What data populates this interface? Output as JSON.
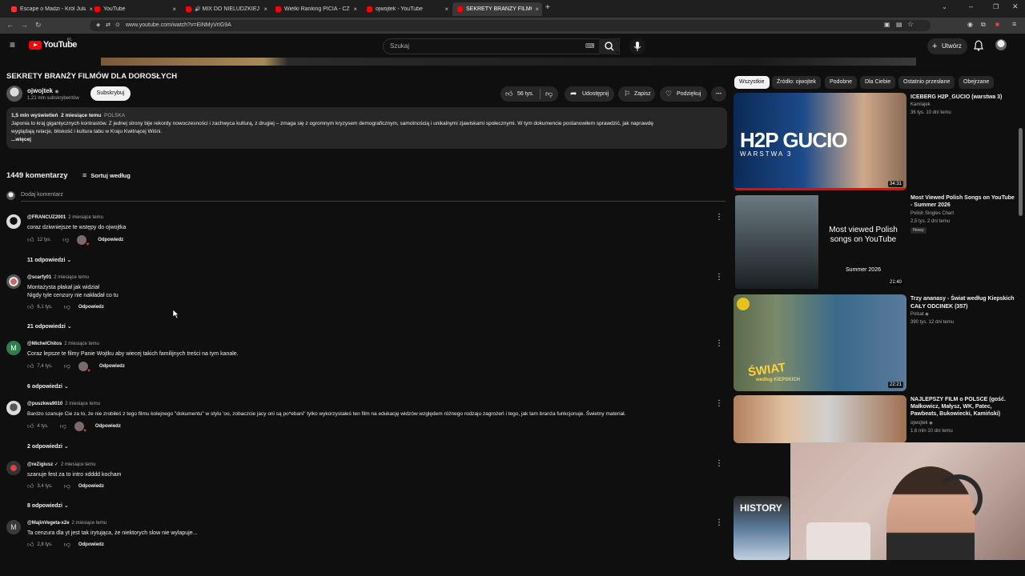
{
  "browser": {
    "tabs": [
      {
        "label": "Escape o Madzi - Król Julian &",
        "fav_color": "#ff3030"
      },
      {
        "label": "YouTube",
        "fav_color": "#ff0000"
      },
      {
        "label": "MIX DO NIELUDZKIEJ PI",
        "fav_color": "#ff0000"
      },
      {
        "label": "Wielki Ranking PICIA - CZEGO",
        "fav_color": "#ff0000"
      },
      {
        "label": "ojwojtek - YouTube",
        "fav_color": "#ff0000"
      },
      {
        "label": "SEKRETY BRANŻY FILMÓW DLA",
        "fav_color": "#ff0000"
      }
    ],
    "url": "www.youtube.com/watch?v=EiNMyVrIG9A",
    "new_tab": "+",
    "close": "×"
  },
  "header": {
    "logo_text": "YouTube",
    "logo_region": "PL",
    "search_placeholder": "Szukaj",
    "create_label": "Utwórz"
  },
  "video": {
    "title": "SEKRETY BRANŻY FILMÓW DLA DOROSŁYCH",
    "channel": "ojwojtek",
    "subscribers": "1,21 mln subskrybentów",
    "subscribe_label": "Subskrybuj",
    "likes": "56 tys.",
    "share_label": "Udostępnij",
    "save_label": "Zapisz",
    "thanks_label": "Podziękuj",
    "views": "1,5 mln wyświetleń",
    "date": "2 miesiące temu",
    "country": "POLSKA",
    "description_1": "Japonia to kraj gigantycznych kontrastów. Z jednej strony bije rekordy nowoczesności i zachwyca kulturą, z drugiej – zmaga się z ogromnym kryzysem demograficznym, samotnością i unikalnymi zjawiskami społecznymi. W tym dokumencie postanowiłem sprawdzić, jak naprawdę",
    "description_2": "wyglądają relacje, bliskość i kultura tabu w Kraju Kwitnącej Wiśni.",
    "more_label": "...więcej"
  },
  "comments": {
    "count_label": "1449 komentarzy",
    "sort_label": "Sortuj według",
    "add_placeholder": "Dodaj komentarz",
    "reply_label": "Odpowiedz",
    "items": [
      {
        "author": "@FRANCUZ2001",
        "time": "2 miesiące temu",
        "line1": "coraz dziwniejsze te wstępy do ojwojtka",
        "line2": "",
        "likes": "12 tys.",
        "hearted": true,
        "replies": "11 odpowiedzi"
      },
      {
        "author": "@scarfy01",
        "time": "2 miesiące temu",
        "line1": "Montażysta płakał jak widział",
        "line2": "Nigdy tyle cenzury nie nakładał co tu",
        "likes": "6,1 tys.",
        "hearted": false,
        "replies": "21 odpowiedzi"
      },
      {
        "author": "@MichelChitos",
        "time": "2 miesiące temu",
        "line1": "Coraz lepsze te filmy Panie Wojtku aby wiecej takich familijnych treści na tym kanale.",
        "line2": "",
        "likes": "7,4 tys.",
        "hearted": true,
        "replies": "6 odpowiedzi"
      },
      {
        "author": "@puszkwa9010",
        "time": "2 miesiące temu",
        "line1": "Bardzo szanuje Cie za to, że nie zrobiłeś z tego filmu kolejnego \"dokumentu\" w stylu 'oo, zobaczcie jacy oni są po*ebani\" tylko wykorzystałeś ten film na edukację widzów względem różnego rodzaju zagrożeń i tego, jak tam branża funkcjonuje. Świetny materiał.",
        "line2": "",
        "likes": "4 tys.",
        "hearted": true,
        "replies": "2 odpowiedzi"
      },
      {
        "author": "@reZigiusz ✓",
        "time": "2 miesiące temu",
        "line1": "szanuje fest za to intro xdddd kocham",
        "line2": "",
        "likes": "3,4 tys.",
        "hearted": false,
        "replies": "8 odpowiedzi"
      },
      {
        "author": "@MajinVegeta-x2e",
        "time": "2 miesiące temu",
        "line1": "Ta cenzura dla yt jest tak irytująca,  że niektorych slow nie wylapuje...",
        "line2": "",
        "likes": "2,8 tys.",
        "hearted": false,
        "replies": ""
      }
    ]
  },
  "sidebar": {
    "chips": [
      "Wszystkie",
      "Źródło: ojwojtek",
      "Podobne",
      "Dla Ciebie",
      "Ostatnio przesłane",
      "Obejrzane"
    ],
    "videos": [
      {
        "title_1": "ICEBERG H2P_GUCIO (warstwa 3)",
        "title_2": "",
        "channel": "Kamlajek",
        "meta": "36 tys.  10 dni temu",
        "badge": "",
        "duration": "34:31",
        "thumb_text": "H2P GUCIO",
        "thumb_sub": "WARSTWA 3"
      },
      {
        "title_1": "Most Viewed Polish Songs on YouTube",
        "title_2": "- Summer 2026",
        "channel": "Polish Singles Chart",
        "meta": "2,5 tys.  2 dni temu",
        "badge": "Nowy",
        "duration": "21:40",
        "thumb_text": "Most viewed Polish songs on YouTube",
        "thumb_sub": "Summer 2026"
      },
      {
        "title_1": "Trzy ananasy - Świat według Kiepskich -",
        "title_2": "CAŁY ODCINEK (357)",
        "channel": "Polsat",
        "meta": "390 tys.  12 dni temu",
        "badge": "",
        "duration": "22:21",
        "thumb_text": "ŚWIAT",
        "thumb_sub": "według KIEPSKICH"
      },
      {
        "title_1": "NAJLEPSZY FILM o POLSCE (gość.",
        "title_2": "Małkowicz, Małysz, WK, Patec, Pawbeats, Bukowiecki, Kamiński)",
        "channel": "ojwojtek",
        "meta": "1,6 mln  10 dni temu",
        "badge": "",
        "duration": "",
        "thumb_text": "",
        "thumb_sub": ""
      }
    ],
    "history_text": "HISTORY"
  }
}
